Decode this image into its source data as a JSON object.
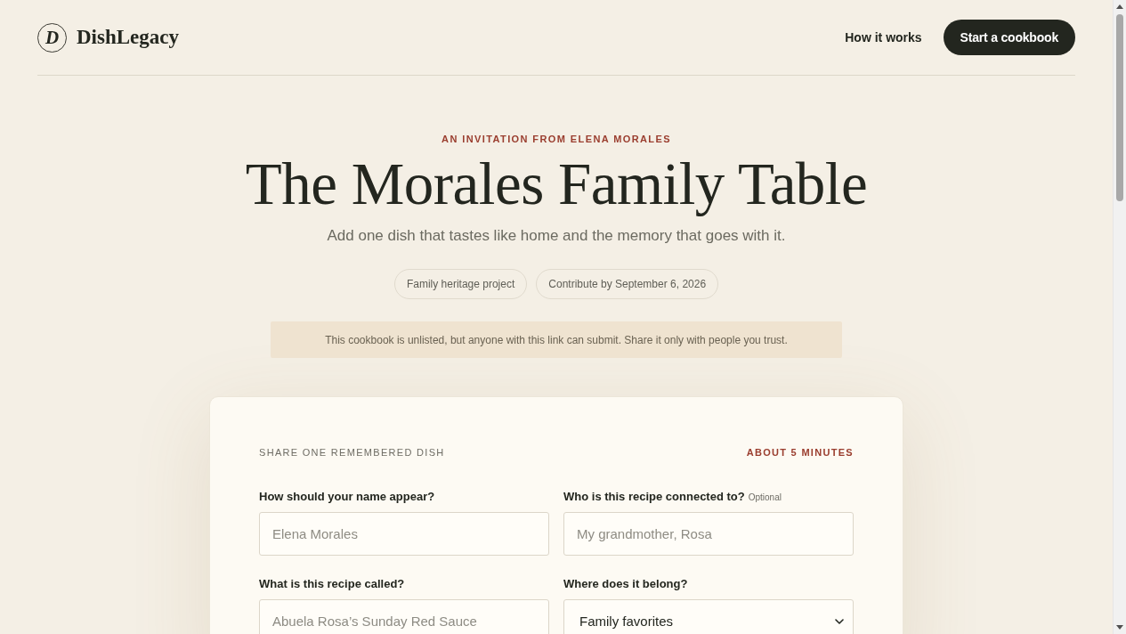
{
  "header": {
    "logo_letter": "D",
    "brand": "DishLegacy",
    "nav_link": "How it works",
    "cta_button": "Start a cookbook"
  },
  "hero": {
    "eyebrow": "AN INVITATION FROM ELENA MORALES",
    "title": "The Morales Family Table",
    "subtitle": "Add one dish that tastes like home and the memory that goes with it.",
    "chips": [
      "Family heritage project",
      "Contribute by September 6, 2026"
    ],
    "notice": "This cookbook is unlisted, but anyone with this link can submit. Share it only with people you trust."
  },
  "form": {
    "section_label": "SHARE ONE REMEMBERED DISH",
    "time_estimate": "ABOUT 5 MINUTES",
    "fields": [
      {
        "kind": "text",
        "label": "How should your name appear?",
        "placeholder": "Elena Morales"
      },
      {
        "kind": "text",
        "label": "Who is this recipe connected to?",
        "hint": "Optional",
        "placeholder": "My grandmother, Rosa"
      },
      {
        "kind": "text",
        "label": "What is this recipe called?",
        "placeholder": "Abuela Rosa’s Sunday Red Sauce"
      },
      {
        "kind": "select",
        "label": "Where does it belong?",
        "value": "Family favorites"
      }
    ]
  }
}
